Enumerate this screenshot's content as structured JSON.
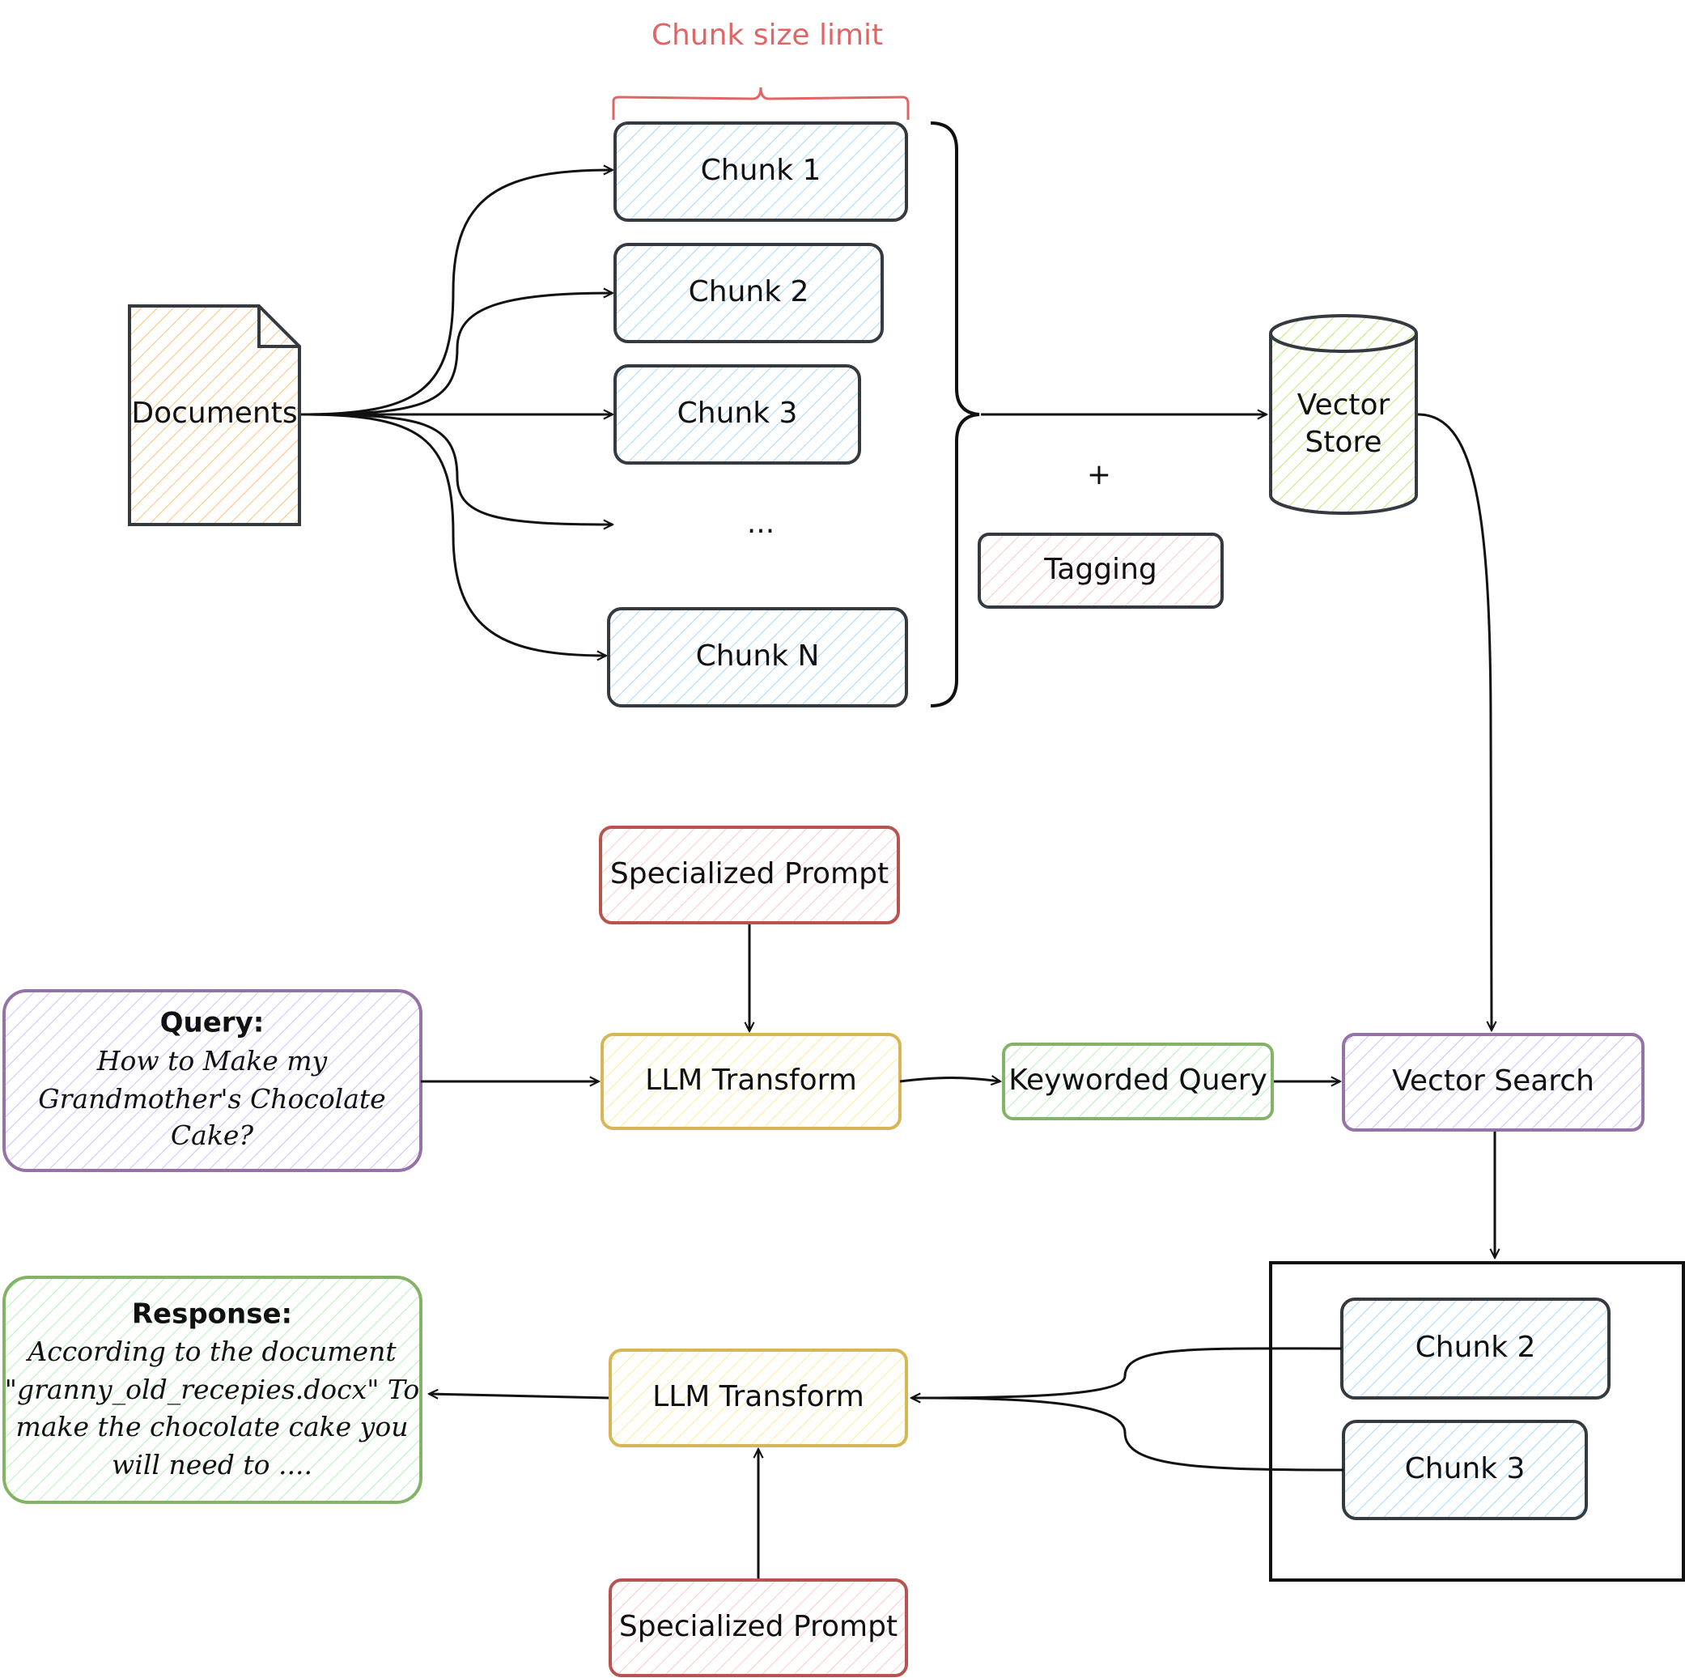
{
  "diagram": {
    "annotation": {
      "chunk_size_limit": "Chunk size limit"
    },
    "nodes": {
      "documents": "Documents",
      "chunk1": "Chunk 1",
      "chunk2": "Chunk 2",
      "chunk3": "Chunk 3",
      "ellipsis": "...",
      "chunkN": "Chunk N",
      "plus": "+",
      "tagging": "Tagging",
      "vector_store_line1": "Vector",
      "vector_store_line2": "Store",
      "specialized_prompt_top": "Specialized Prompt",
      "query_title": "Query:",
      "query_line1": "How to Make my",
      "query_line2": "Grandmother's Chocolate",
      "query_line3": "Cake?",
      "llm_transform_top": "LLM Transform",
      "keyworded_query": "Keyworded Query",
      "vector_search": "Vector Search",
      "result_chunk2": "Chunk 2",
      "result_chunk3": "Chunk 3",
      "llm_transform_bottom": "LLM Transform",
      "specialized_prompt_bottom": "Specialized Prompt",
      "response_title": "Response:",
      "response_line1": "According to the document",
      "response_line2": "\"granny_old_recepies.docx\" To",
      "response_line3": "make the chocolate cake you",
      "response_line4": "will need to ...."
    },
    "colors": {
      "blue_fill": "#a5d8ff",
      "orange_fill": "#ffc078",
      "green_fill": "#b2f2bb",
      "lime_fill": "#c0eb75",
      "red_fill": "#ffc9c9",
      "purple_fill": "#d0bfff",
      "yellow_fill": "#ffec99",
      "red_stroke": "#b85450",
      "purple_stroke": "#9673a6",
      "green_stroke": "#82b366",
      "gold_stroke": "#d6b656",
      "dark_stroke": "#343a40",
      "annotation_red": "#e06666"
    }
  }
}
